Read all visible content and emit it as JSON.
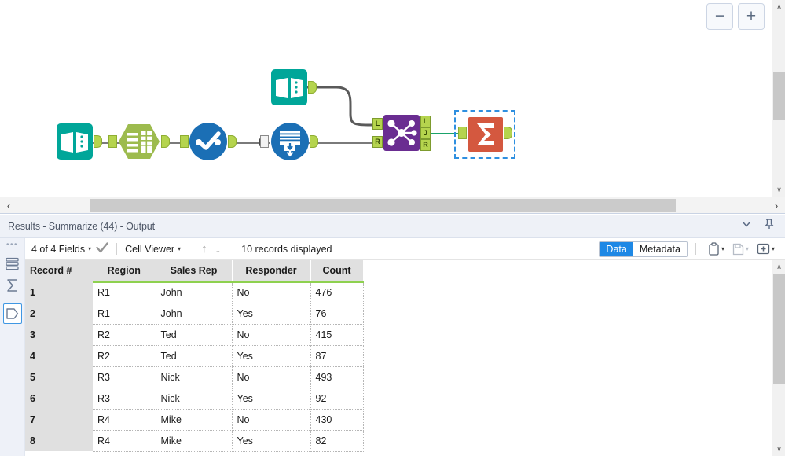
{
  "canvas": {
    "zoom_out_label": "−",
    "zoom_in_label": "+",
    "tools": [
      {
        "name": "input-data-1",
        "icon": "book-icon",
        "label": "Input Data"
      },
      {
        "name": "select",
        "icon": "select-grid-icon",
        "label": "Select"
      },
      {
        "name": "filter",
        "icon": "check-circle-icon",
        "label": "Filter"
      },
      {
        "name": "union",
        "icon": "union-stack-icon",
        "label": "Union"
      },
      {
        "name": "input-data-2",
        "icon": "book-icon",
        "label": "Input Data"
      },
      {
        "name": "join",
        "icon": "join-node-icon",
        "label": "Join"
      },
      {
        "name": "summarize",
        "icon": "sigma-icon",
        "label": "Summarize"
      }
    ],
    "join_anchors": {
      "in_left": "L",
      "in_right": "R",
      "out_left": "L",
      "out_join": "J",
      "out_right": "R"
    },
    "scroll_left_label": "‹",
    "scroll_right_label": "›",
    "scroll_up_label": "∧",
    "scroll_down_label": "∨"
  },
  "results_title": {
    "text": "Results - Summarize (44) - Output",
    "collapse_label": "⌄",
    "pin_label": "pin-icon"
  },
  "sidebar": {
    "drag_handle": "•••",
    "items": [
      {
        "name": "sidebar-item-all-tools",
        "icon": "layers-icon",
        "selected": false
      },
      {
        "name": "sidebar-item-summarize",
        "icon": "sigma-icon",
        "selected": false
      },
      {
        "name": "sidebar-item-output",
        "icon": "output-icon",
        "selected": true
      }
    ]
  },
  "toolbar": {
    "fields_label": "4 of 4 Fields",
    "caret": "▾",
    "check_icon": "check-icon",
    "viewer_label": "Cell Viewer",
    "nav_up": "↑",
    "nav_down": "↓",
    "records_label": "10 records displayed",
    "data_tab": "Data",
    "metadata_tab": "Metadata",
    "active_tab": "Data",
    "copy_icon": "clipboard-icon",
    "save_icon": "save-icon",
    "add_icon": "add-box-icon"
  },
  "grid": {
    "record_header": "Record #",
    "columns": [
      "Region",
      "Sales Rep",
      "Responder",
      "Count"
    ],
    "rows": [
      {
        "n": "1",
        "cells": [
          "R1",
          "John",
          "No",
          "476"
        ]
      },
      {
        "n": "2",
        "cells": [
          "R1",
          "John",
          "Yes",
          "76"
        ]
      },
      {
        "n": "3",
        "cells": [
          "R2",
          "Ted",
          "No",
          "415"
        ]
      },
      {
        "n": "4",
        "cells": [
          "R2",
          "Ted",
          "Yes",
          "87"
        ]
      },
      {
        "n": "5",
        "cells": [
          "R3",
          "Nick",
          "No",
          "493"
        ]
      },
      {
        "n": "6",
        "cells": [
          "R3",
          "Nick",
          "Yes",
          "92"
        ]
      },
      {
        "n": "7",
        "cells": [
          "R4",
          "Mike",
          "No",
          "430"
        ]
      },
      {
        "n": "8",
        "cells": [
          "R4",
          "Mike",
          "Yes",
          "82"
        ]
      }
    ]
  },
  "colors": {
    "input_teal": "#00a699",
    "select_green": "#9dbb4e",
    "filter_blue": "#1b6fb5",
    "union_blue": "#1b6fb5",
    "join_purple": "#6a2d91",
    "summarize_orange": "#d4583f",
    "anchor_green": "#b5d44e",
    "header_underline": "#8ed14f",
    "accent_blue": "#1e88e5",
    "selection_blue": "#2e8fe0"
  }
}
